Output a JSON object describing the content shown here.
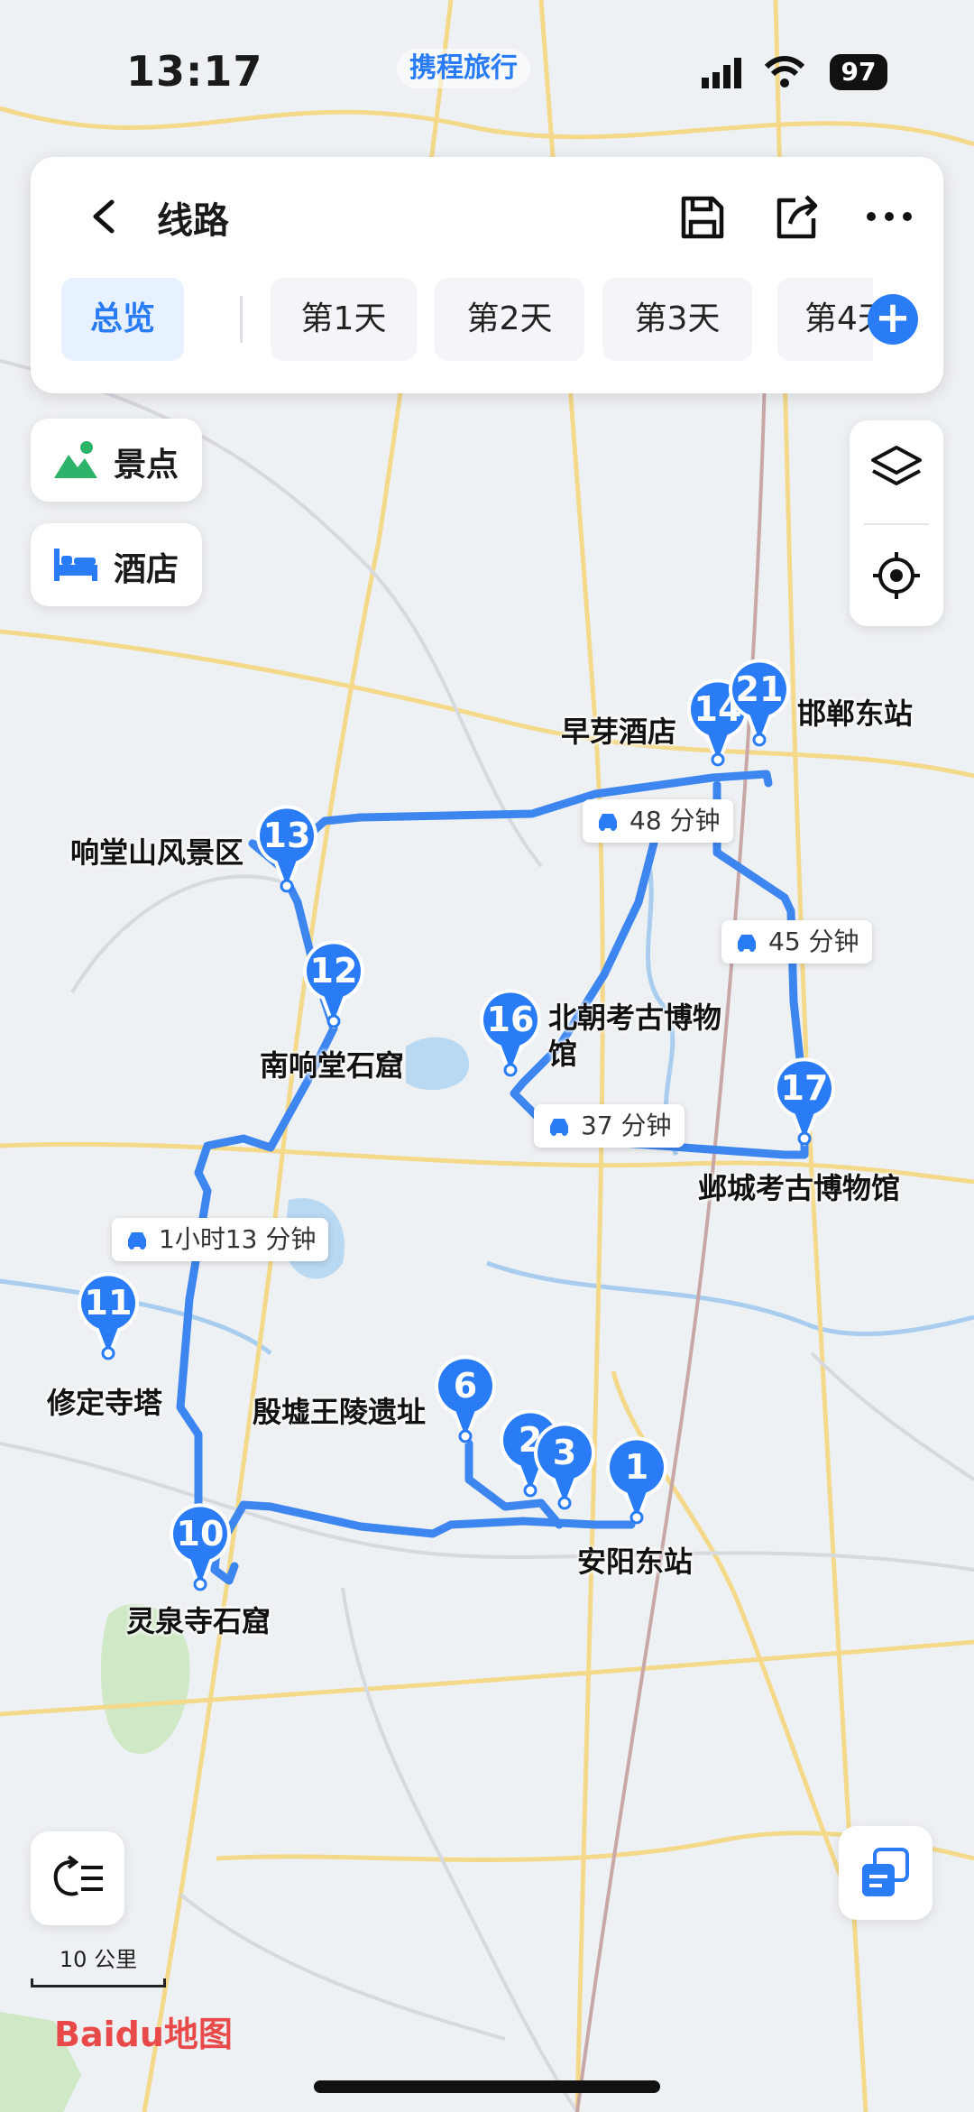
{
  "status_bar": {
    "time": "13:17",
    "app_badge": "携程旅行",
    "battery": "97"
  },
  "header": {
    "title": "线路"
  },
  "tabs": [
    "总览",
    "第1天",
    "第2天",
    "第3天",
    "第4天"
  ],
  "filters": {
    "spots": "景点",
    "hotels": "酒店"
  },
  "places": [
    {
      "num": "1",
      "name": "安阳东站"
    },
    {
      "num": "2",
      "name": ""
    },
    {
      "num": "3",
      "name": ""
    },
    {
      "num": "6",
      "name": "殷墟王陵遗址"
    },
    {
      "num": "10",
      "name": "灵泉寺石窟"
    },
    {
      "num": "11",
      "name": "修定寺塔"
    },
    {
      "num": "12",
      "name": "南响堂石窟"
    },
    {
      "num": "13",
      "name": "响堂山风景区"
    },
    {
      "num": "14",
      "name": "早芽酒店"
    },
    {
      "num": "16",
      "name": "北朝考古博物馆"
    },
    {
      "num": "17",
      "name": "邺城考古博物馆"
    },
    {
      "num": "21",
      "name": "邯郸东站"
    }
  ],
  "durations": [
    "48 分钟",
    "45 分钟",
    "37 分钟",
    "1小时13 分钟"
  ],
  "scale": "10 公里",
  "logo": "Baidu地图",
  "colors": {
    "accent": "#2a7cf6",
    "route": "#3d86f0"
  }
}
